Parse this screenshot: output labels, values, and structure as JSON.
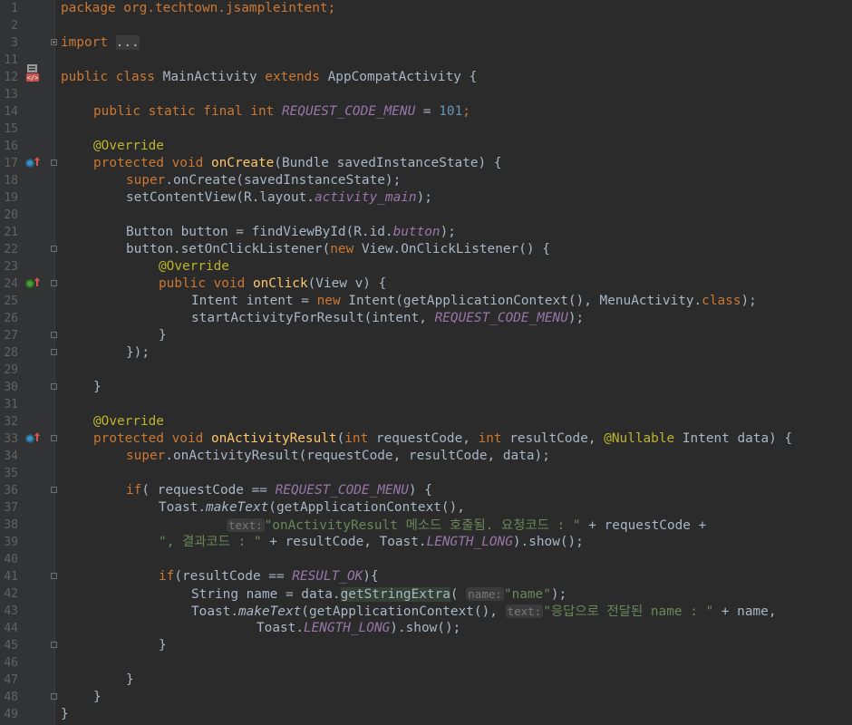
{
  "lines": [
    {
      "n": "1",
      "t": "package org.techtown.jsampleintent;"
    },
    {
      "n": "2",
      "t": ""
    },
    {
      "n": "3",
      "t_import": "import",
      "t_folded": "..."
    },
    {
      "n": "11",
      "t": ""
    },
    {
      "n": "12",
      "t_public": "public",
      "t_class": "class",
      "t_name": "MainActivity",
      "t_extends": "extends",
      "t_parent": "AppCompatActivity {"
    },
    {
      "n": "13",
      "t": ""
    },
    {
      "n": "14",
      "t_mods": "public static final int",
      "t_const": "REQUEST_CODE_MENU",
      "t_eq": " = ",
      "t_num": "101",
      "t_end": ";"
    },
    {
      "n": "15",
      "t": ""
    },
    {
      "n": "16",
      "t_ann": "@Override"
    },
    {
      "n": "17",
      "t_kw": "protected void",
      "t_fn": "onCreate",
      "t_rest": "(Bundle savedInstanceState) {"
    },
    {
      "n": "18",
      "t_super": "super",
      "t_rest": ".onCreate(savedInstanceState);"
    },
    {
      "n": "19",
      "t_a": "setContentView(R.layout.",
      "t_field": "activity_main",
      "t_b": ");"
    },
    {
      "n": "20",
      "t": ""
    },
    {
      "n": "21",
      "t_a": "Button button = findViewById(R.id.",
      "t_field": "button",
      "t_b": ");"
    },
    {
      "n": "22",
      "t_a": "button.setOnClickListener(",
      "t_new": "new",
      "t_b": " View.OnClickListener() {"
    },
    {
      "n": "23",
      "t_ann": "@Override"
    },
    {
      "n": "24",
      "t_kw": "public void",
      "t_fn": "onClick",
      "t_rest": "(View v) {"
    },
    {
      "n": "25",
      "t_a": "Intent intent = ",
      "t_new": "new",
      "t_b": " Intent(getApplicationContext(), MenuActivity.",
      "t_cls": "class",
      "t_c": ");"
    },
    {
      "n": "26",
      "t_a": "startActivityForResult(intent, ",
      "t_const": "REQUEST_CODE_MENU",
      "t_b": ");"
    },
    {
      "n": "27",
      "t": "}"
    },
    {
      "n": "28",
      "t": "});"
    },
    {
      "n": "29",
      "t": ""
    },
    {
      "n": "30",
      "t": "}"
    },
    {
      "n": "31",
      "t": ""
    },
    {
      "n": "32",
      "t_ann": "@Override"
    },
    {
      "n": "33",
      "t_kw": "protected void",
      "t_fn": "onActivityResult",
      "t_a": "(",
      "t_int1": "int",
      "t_b": " requestCode, ",
      "t_int2": "int",
      "t_c": " resultCode, ",
      "t_ann2": "@Nullable",
      "t_d": " Intent data) {"
    },
    {
      "n": "34",
      "t_super": "super",
      "t_rest": ".onActivityResult(requestCode, resultCode, data);"
    },
    {
      "n": "35",
      "t": ""
    },
    {
      "n": "36",
      "t_if": "if",
      "t_a": "( requestCode == ",
      "t_const": "REQUEST_CODE_MENU",
      "t_b": ") {"
    },
    {
      "n": "37",
      "t_a": "Toast.",
      "t_static": "makeText",
      "t_b": "(getApplicationContext(),"
    },
    {
      "n": "38",
      "t_hint": "text:",
      "t_str": "\"onActivityResult 메소드 호출됨. 요청코드 : \"",
      "t_b": " + requestCode +"
    },
    {
      "n": "39",
      "t_str": "\", 결과코드 : \"",
      "t_a": " + resultCode, Toast.",
      "t_const": "LENGTH_LONG",
      "t_b": ").show();"
    },
    {
      "n": "40",
      "t": ""
    },
    {
      "n": "41",
      "t_if": "if",
      "t_a": "(resultCode == ",
      "t_const": "RESULT_OK",
      "t_b": "){"
    },
    {
      "n": "42",
      "t_a": "String name = data.",
      "t_hl": "getStringExtra",
      "t_b": "(",
      "t_hint": "name:",
      "t_str": "\"name\"",
      "t_c": ");"
    },
    {
      "n": "43",
      "t_a": "Toast.",
      "t_static": "makeText",
      "t_b": "(getApplicationContext(), ",
      "t_hint": "text:",
      "t_str": "\"응답으로 전달된 name : \"",
      "t_c": " + name,"
    },
    {
      "n": "44",
      "t_a": "Toast.",
      "t_const": "LENGTH_LONG",
      "t_b": ").show();"
    },
    {
      "n": "45",
      "t": "}"
    },
    {
      "n": "46",
      "t": ""
    },
    {
      "n": "47",
      "t": "}"
    },
    {
      "n": "48",
      "t": "}"
    },
    {
      "n": "49",
      "t": "}"
    }
  ]
}
